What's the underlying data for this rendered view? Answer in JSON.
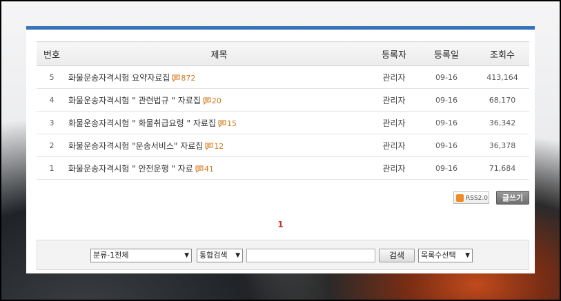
{
  "table": {
    "headers": {
      "num": "번호",
      "title": "제목",
      "author": "등록자",
      "date": "등록일",
      "views": "조회수"
    },
    "rows": [
      {
        "num": "5",
        "title": "화물운송자격시험 요약자료집",
        "comments": "872",
        "author": "관리자",
        "date": "09-16",
        "views": "413,164"
      },
      {
        "num": "4",
        "title": "화물운송자격시험 \" 관련법규 \" 자료집",
        "comments": "20",
        "author": "관리자",
        "date": "09-16",
        "views": "68,170"
      },
      {
        "num": "3",
        "title": "화물운송자격시험 \" 화물취급요령 \" 자료집",
        "comments": "15",
        "author": "관리자",
        "date": "09-16",
        "views": "36,342"
      },
      {
        "num": "2",
        "title": "화물운송자격시험 \"운송서비스\" 자료집",
        "comments": "12",
        "author": "관리자",
        "date": "09-16",
        "views": "36,378"
      },
      {
        "num": "1",
        "title": "화물운송자격시험 \" 안전운행 \" 자료",
        "comments": "41",
        "author": "관리자",
        "date": "09-16",
        "views": "71,684"
      }
    ]
  },
  "buttons": {
    "rss": "RSS2.0",
    "write": "글쓰기"
  },
  "pagination": {
    "current": "1"
  },
  "search": {
    "category": "분류-1전체",
    "type": "통합검색",
    "query": "",
    "submit": "검색",
    "list_count": "목록수선택"
  },
  "colors": {
    "topbar": "#3a72b8",
    "comment": "#d07a20",
    "current_page": "#c0392b"
  }
}
